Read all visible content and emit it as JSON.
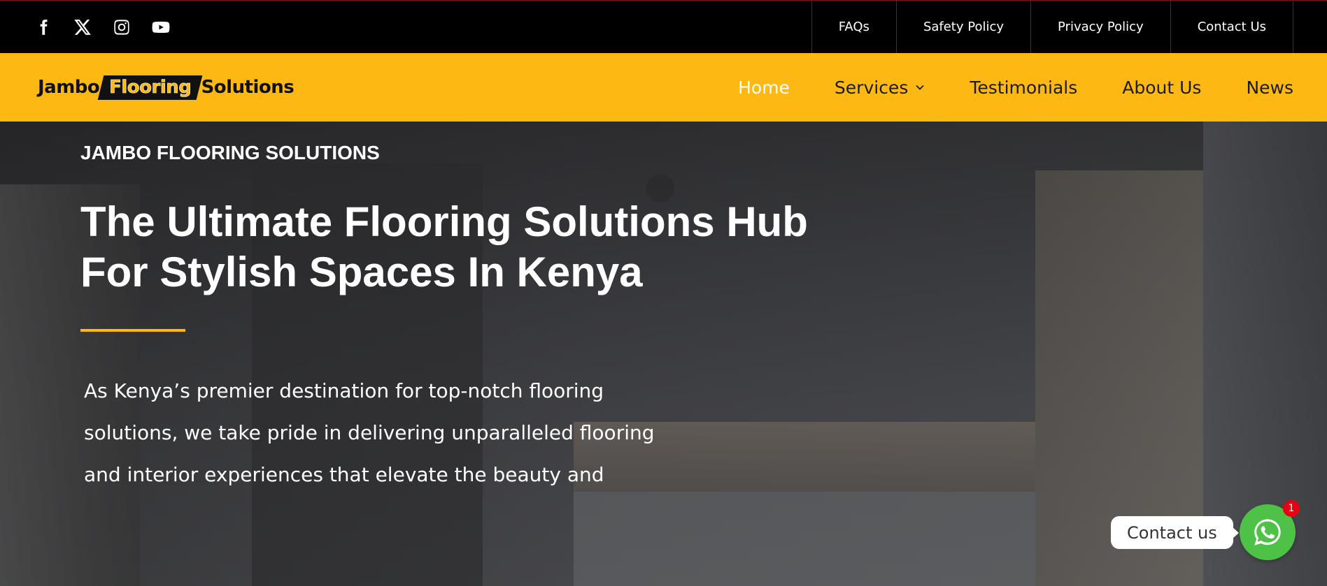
{
  "topbar": {
    "social": [
      {
        "icon": "facebook-icon"
      },
      {
        "icon": "x-twitter-icon"
      },
      {
        "icon": "instagram-icon"
      },
      {
        "icon": "youtube-icon"
      }
    ],
    "links": [
      "FAQs",
      "Safety Policy",
      "Privacy Policy",
      "Contact Us"
    ]
  },
  "nav": {
    "logo": {
      "left": "Jambo",
      "badge": "Flooring",
      "right": "Solutions"
    },
    "items": [
      {
        "label": "Home",
        "active": true
      },
      {
        "label": "Services",
        "has_dropdown": true
      },
      {
        "label": "Testimonials"
      },
      {
        "label": "About Us"
      },
      {
        "label": "News"
      }
    ]
  },
  "hero": {
    "eyebrow": "JAMBO FLOORING SOLUTIONS",
    "headline_line1": "The Ultimate Flooring Solutions Hub",
    "headline_line2": "For Stylish Spaces In Kenya",
    "lead_line1": "As Kenya’s premier destination for top-notch flooring",
    "lead_line2": "solutions, we take pride in delivering unparalleled flooring",
    "lead_line3": "and interior experiences that elevate the beauty and"
  },
  "whatsapp": {
    "label": "Contact us",
    "badge_count": "1",
    "icon": "whatsapp-icon"
  },
  "colors": {
    "brand_yellow": "#fdb813",
    "topbar_bg": "#000000",
    "whatsapp_green": "#4dc247",
    "badge_red": "#e60012"
  }
}
